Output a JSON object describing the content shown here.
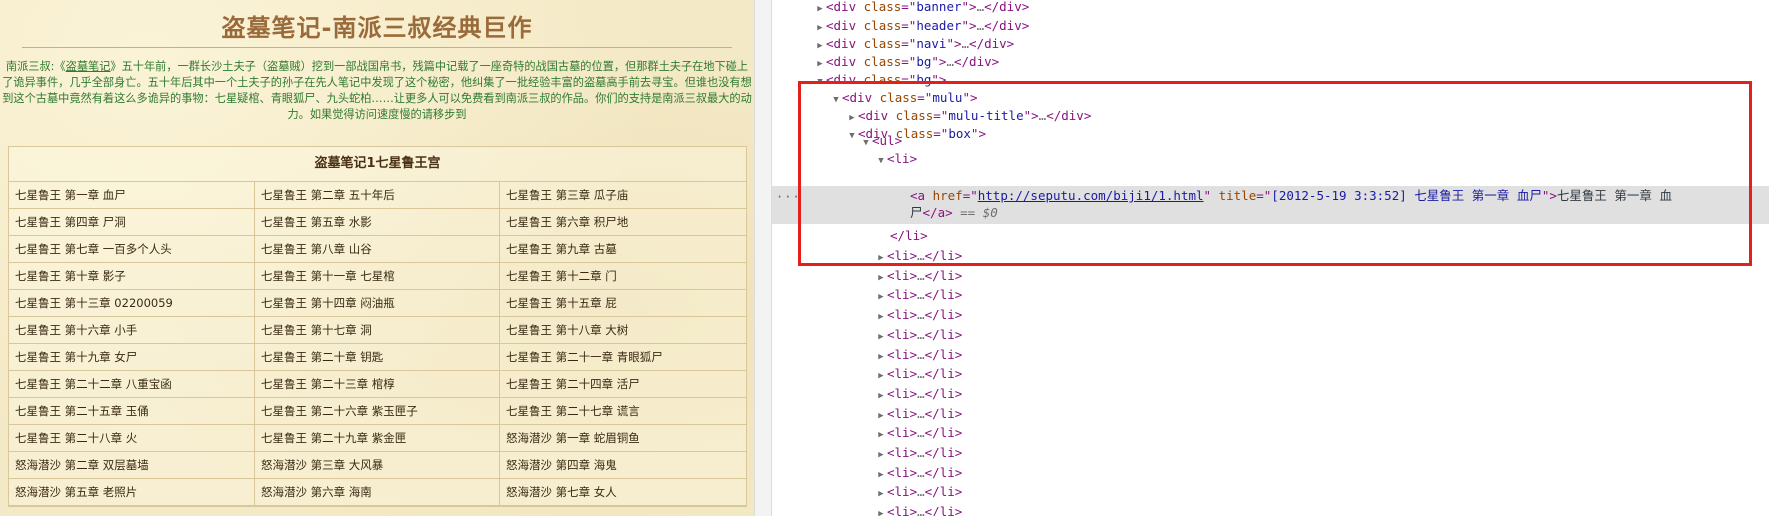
{
  "page": {
    "title": "盗墓笔记-南派三叔经典巨作",
    "intro_prefix": "南派三叔:《",
    "intro_link": "盗墓笔记",
    "intro_rest": "》五十年前，一群长沙土夫子（盗墓贼）挖到一部战国帛书，残篇中记载了一座奇特的战国古墓的位置，但那群土夫子在地下碰上了诡异事件，几乎全部身亡。五十年后其中一个土夫子的孙子在先人笔记中发现了这个秘密，他纠集了一批经验丰富的盗墓高手前去寻宝。但谁也没有想到这个古墓中竟然有着这么多诡异的事物：七星疑棺、青眼狐尸、九头蛇柏……让更多人可以免费看到南派三叔的作品。你们的支持是南派三叔最大的动力。如果觉得访问速度慢的请移步到",
    "mulu_title": "盗墓笔记1七星鲁王宫",
    "chapters": [
      "七星鲁王 第一章 血尸",
      "七星鲁王 第二章 五十年后",
      "七星鲁王 第三章 瓜子庙",
      "七星鲁王 第四章 尸洞",
      "七星鲁王 第五章 水影",
      "七星鲁王 第六章 积尸地",
      "七星鲁王 第七章 一百多个人头",
      "七星鲁王 第八章 山谷",
      "七星鲁王 第九章 古墓",
      "七星鲁王 第十章 影子",
      "七星鲁王 第十一章 七星棺",
      "七星鲁王 第十二章 门",
      "七星鲁王 第十三章 02200059",
      "七星鲁王 第十四章 闷油瓶",
      "七星鲁王 第十五章 屁",
      "七星鲁王 第十六章 小手",
      "七星鲁王 第十七章 洞",
      "七星鲁王 第十八章 大树",
      "七星鲁王 第十九章 女尸",
      "七星鲁王 第二十章 钥匙",
      "七星鲁王 第二十一章 青眼狐尸",
      "七星鲁王 第二十二章 八重宝函",
      "七星鲁王 第二十三章 棺椁",
      "七星鲁王 第二十四章 活尸",
      "七星鲁王 第二十五章 玉俑",
      "七星鲁王 第二十六章 紫玉匣子",
      "七星鲁王 第二十七章 谎言",
      "七星鲁王 第二十八章 火",
      "七星鲁王 第二十九章 紫金匣",
      "怒海潜沙 第一章 蛇眉铜鱼",
      "怒海潜沙 第二章 双层墓墙",
      "怒海潜沙 第三章 大风暴",
      "怒海潜沙 第四章 海鬼",
      "怒海潜沙 第五章 老照片",
      "怒海潜沙 第六章 海南",
      "怒海潜沙 第七章 女人"
    ]
  },
  "devtools": {
    "rows": [
      {
        "indent": 0,
        "tri": "▶",
        "cls": "banner",
        "collapsed": true
      },
      {
        "indent": 0,
        "tri": "▶",
        "cls": "header",
        "collapsed": true
      },
      {
        "indent": 0,
        "tri": "▶",
        "cls": "navi",
        "collapsed": true
      },
      {
        "indent": 0,
        "tri": "▶",
        "cls": "bg",
        "collapsed": true
      },
      {
        "indent": 0,
        "tri": "▼",
        "cls": "bg",
        "collapsed": false
      },
      {
        "indent": 1,
        "tri": "▼",
        "cls": "mulu",
        "collapsed": false
      },
      {
        "indent": 2,
        "tri": "▶",
        "cls": "mulu-title",
        "collapsed": true
      },
      {
        "indent": 2,
        "tri": "▼",
        "cls": "box",
        "collapsed": false
      }
    ],
    "ul_tag": "ul",
    "li_tag": "li",
    "anchor": {
      "href": "http://seputu.com/biji1/1.html",
      "title": "[2012-5-19 3:3:52] 七星鲁王 第一章 血尸",
      "text_line1": "七星鲁王 第一章 血",
      "text_line2": "尸"
    },
    "eq_marker": "== $0",
    "collapsed_li_count": 14,
    "ellipsis": "···"
  },
  "colors": {
    "page_bg": "#f4e9c6",
    "title": "#9a6a3a",
    "intro_text": "#2f7a2f",
    "highlight_border": "#e3201b",
    "tag": "#881280",
    "attr_name": "#994500",
    "attr_value": "#1a1aa6"
  }
}
